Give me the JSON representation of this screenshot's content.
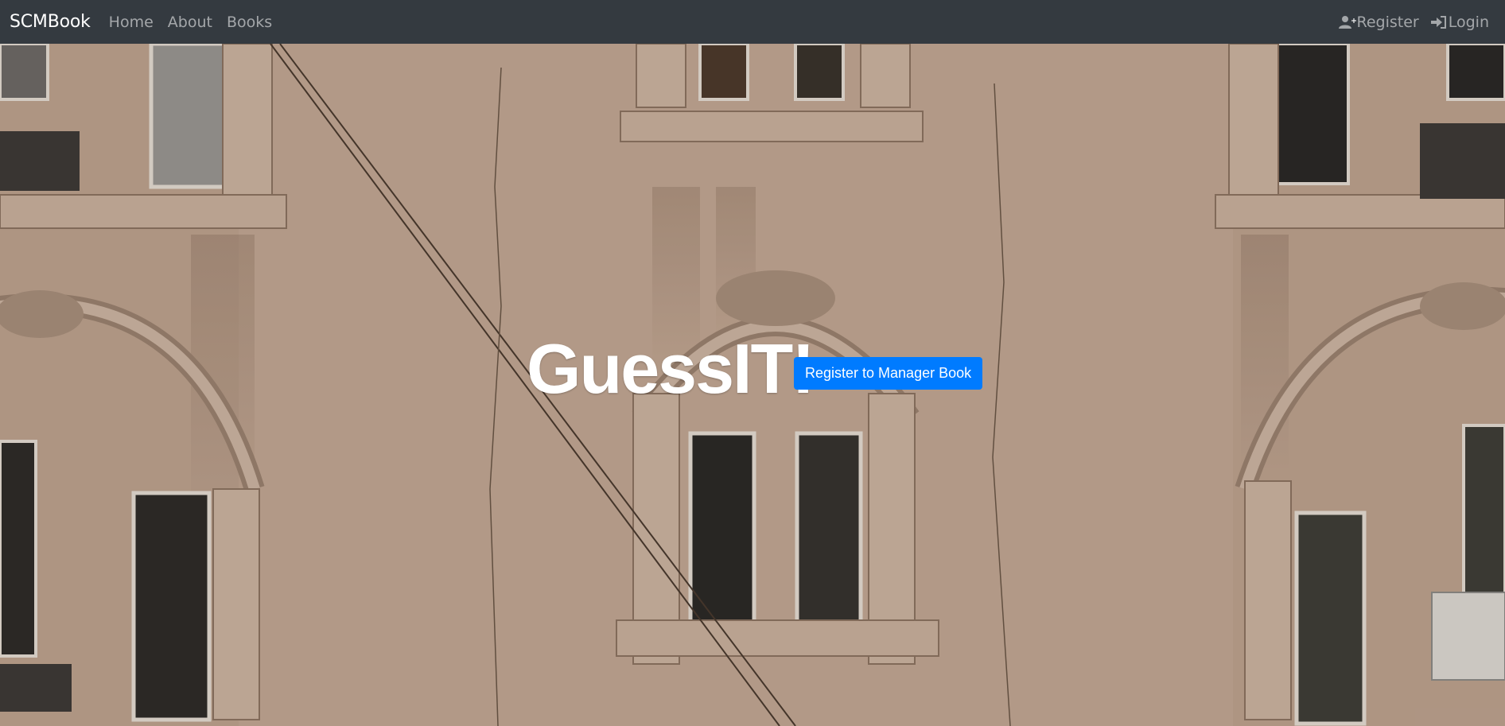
{
  "navbar": {
    "brand": "SCMBook",
    "links": [
      "Home",
      "About",
      "Books"
    ],
    "register_label": "Register",
    "login_label": "Login"
  },
  "hero": {
    "title": "GuessIT!",
    "cta_label": "Register to Manager Book"
  },
  "colors": {
    "navbar_bg": "#343a40",
    "cta_bg": "#007bff",
    "wall": "#c2a793"
  },
  "icons": [
    "user-plus-icon",
    "sign-in-icon"
  ]
}
